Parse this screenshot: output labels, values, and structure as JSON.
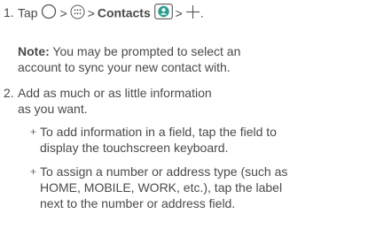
{
  "step1": {
    "number": "1.",
    "tap": "Tap",
    "sep1": ">",
    "sep2": ">",
    "contacts": "Contacts",
    "sep3": ">",
    "end": ".",
    "icons": [
      "home-circle-icon",
      "apps-grid-icon",
      "contacts-person-icon",
      "add-plus-icon"
    ],
    "colors": {
      "contacts_accent": "#2a9d8f"
    }
  },
  "note": {
    "label": "Note:",
    "line1": " You may be prompted to select an",
    "line2": "account to sync your new contact with."
  },
  "step2": {
    "number": "2.",
    "line1": "Add as much or as little information",
    "line2": "as you want."
  },
  "bullets": [
    {
      "marker": "+",
      "lines": [
        "To add information in a field, tap the field to",
        "display the touchscreen keyboard."
      ]
    },
    {
      "marker": "+",
      "lines": [
        "To assign a number or address type (such as",
        "HOME, MOBILE, WORK, etc.), tap the label",
        "next to the number or address field."
      ]
    }
  ]
}
